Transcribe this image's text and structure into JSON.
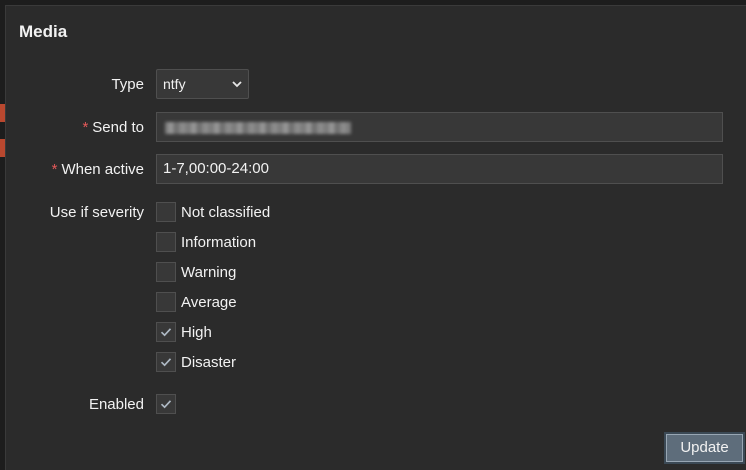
{
  "dialog": {
    "title": "Media"
  },
  "form": {
    "type": {
      "label": "Type",
      "value": "ntfy"
    },
    "send_to": {
      "label": "Send to",
      "required_mark": "*",
      "value_obscured": true
    },
    "when_active": {
      "label": "When active",
      "required_mark": "*",
      "value": "1-7,00:00-24:00"
    },
    "severity": {
      "label": "Use if severity",
      "options": [
        {
          "label": "Not classified",
          "checked": false
        },
        {
          "label": "Information",
          "checked": false
        },
        {
          "label": "Warning",
          "checked": false
        },
        {
          "label": "Average",
          "checked": false
        },
        {
          "label": "High",
          "checked": true
        },
        {
          "label": "Disaster",
          "checked": true
        }
      ]
    },
    "enabled": {
      "label": "Enabled",
      "checked": true
    }
  },
  "actions": {
    "update_label": "Update"
  },
  "colors": {
    "dialog_bg": "#2b2b2b",
    "input_bg": "#383838",
    "required": "#e45959",
    "button_bg": "#5e6d7b"
  }
}
